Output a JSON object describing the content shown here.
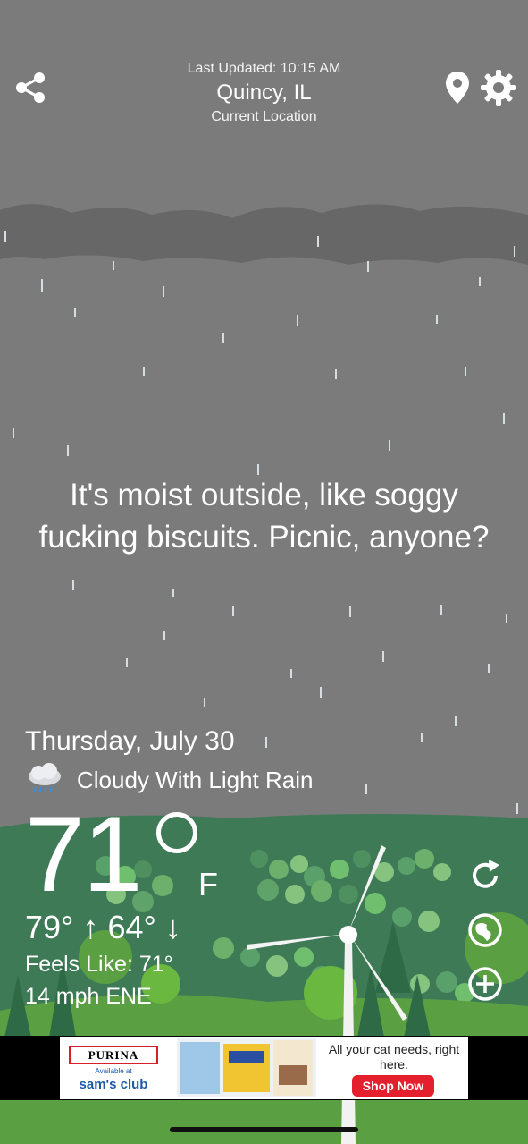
{
  "header": {
    "last_updated": "Last Updated: 10:15 AM",
    "city": "Quincy, IL",
    "location_label": "Current Location"
  },
  "message": "It's moist outside, like soggy fucking biscuits. Picnic, anyone?",
  "forecast": {
    "date": "Thursday, July 30",
    "condition": "Cloudy With Light Rain",
    "temperature": "71",
    "unit": "F",
    "high": "79° ↑",
    "low": "64° ↓",
    "feels_like": "Feels Like: 71°",
    "wind": "14 mph ENE"
  },
  "ad": {
    "brand": "PURINA",
    "available_at": "Available at",
    "retailer": "sam's club",
    "headline": "All your cat needs, right here.",
    "cta": "Shop Now"
  },
  "colors": {
    "sky": "#7b7b7b",
    "cloud": "#666666",
    "hill_back": "#3f7a57",
    "hill_front": "#5aa042",
    "ad_cta": "#e4202e"
  },
  "icons": {
    "share": "share-icon",
    "location": "location-pin-icon",
    "settings": "gear-icon",
    "weather": "rain-cloud-icon",
    "refresh": "refresh-icon",
    "locate": "globe-icon",
    "add": "add-circle-icon"
  }
}
